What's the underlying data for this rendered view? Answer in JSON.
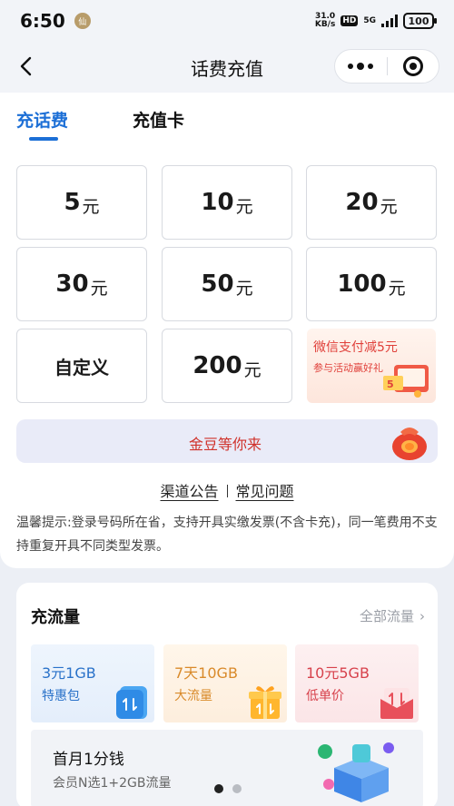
{
  "status": {
    "time": "6:50",
    "small_badge": "仙",
    "net_speed_value": "31.0",
    "net_speed_unit": "KB/s",
    "hd": "HD",
    "net_type": "5G",
    "battery": "100"
  },
  "nav": {
    "title": "话费充值"
  },
  "tabs": [
    {
      "label": "充话费",
      "active": true
    },
    {
      "label": "充值卡",
      "active": false
    }
  ],
  "amounts": [
    {
      "num": "5",
      "unit": "元"
    },
    {
      "num": "10",
      "unit": "元"
    },
    {
      "num": "20",
      "unit": "元"
    },
    {
      "num": "30",
      "unit": "元"
    },
    {
      "num": "50",
      "unit": "元"
    },
    {
      "num": "100",
      "unit": "元"
    },
    {
      "custom": "自定义"
    },
    {
      "num": "200",
      "unit": "元"
    }
  ],
  "promo": {
    "title": "微信支付减5元",
    "subtitle": "参与活动赢好礼"
  },
  "gold_banner": {
    "text": "金豆等你来"
  },
  "links": {
    "announcement": "渠道公告",
    "faq": "常见问题"
  },
  "notice": "温馨提示:登录号码所在省，支持开具实缴发票(不含卡充)，同一笔费用不支持重复开具不同类型发票。",
  "data_section": {
    "title": "充流量",
    "all_label": "全部流量",
    "plans": [
      {
        "name": "3元1GB",
        "desc": "特惠包"
      },
      {
        "name": "7天10GB",
        "desc": "大流量"
      },
      {
        "name": "10元5GB",
        "desc": "低单价"
      }
    ],
    "strip": {
      "title": "首月1分钱",
      "subtitle": "会员N选1+2GB流量"
    },
    "pager": {
      "current": 1,
      "total": 2
    }
  },
  "colors": {
    "accent": "#1c6fd6",
    "promo_red": "#e0403a",
    "page_bg": "#eceff5"
  }
}
